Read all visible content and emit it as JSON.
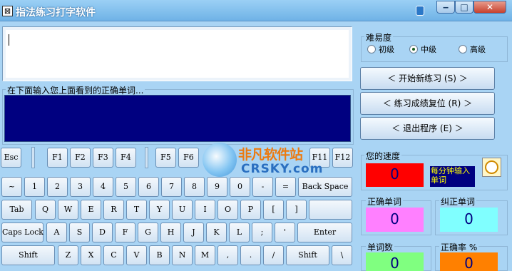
{
  "window": {
    "title": "指法练习打字软件",
    "app_icon_glyph": "⊠"
  },
  "window_controls": {
    "minimize": "‒",
    "maximize": "□",
    "close": "✕"
  },
  "input_prompt": "在下面输入您上面看到的正确单词...",
  "difficulty": {
    "label": "难易度",
    "options": [
      "初级",
      "中级",
      "高级"
    ],
    "selected": "中级"
  },
  "buttons": {
    "new_practice": "＜ 开始新练习 (S) ＞",
    "reset_score": "＜ 练习成绩复位 (R) ＞",
    "exit": "＜ 退出程序 (E) ＞"
  },
  "stats": {
    "speed_label": "您的速度",
    "speed_value": "0",
    "speed_unit": "每分钟输入单词",
    "correct_label": "正确单词",
    "correct_value": "0",
    "corrected_label": "纠正单词",
    "corrected_value": "0",
    "word_count_label": "单词数",
    "word_count_value": "0",
    "accuracy_label": "正确率 %",
    "accuracy_value": "0"
  },
  "watermark": {
    "title": "非凡软件站",
    "subtitle": "CRSKY.com"
  },
  "keyboard": {
    "row0": [
      "Esc",
      "F1",
      "F2",
      "F3",
      "F4",
      "F5",
      "F6",
      "F11",
      "F12"
    ],
    "row1": [
      "~",
      "1",
      "2",
      "3",
      "4",
      "5",
      "6",
      "7",
      "8",
      "9",
      "0",
      "-",
      "=",
      "Back Space"
    ],
    "row2": [
      "Tab",
      "Q",
      "W",
      "E",
      "R",
      "T",
      "Y",
      "U",
      "I",
      "O",
      "P",
      "[",
      "]"
    ],
    "row3": [
      "Caps Lock",
      "A",
      "S",
      "D",
      "F",
      "G",
      "H",
      "J",
      "K",
      "L",
      ";",
      "'",
      "Enter"
    ],
    "row4": [
      "Shift",
      "Z",
      "X",
      "C",
      "V",
      "B",
      "N",
      "M",
      ",",
      ".",
      "/",
      "Shift",
      "\\"
    ]
  },
  "colors": {
    "entry_background": "#000080",
    "speed_box": "#ff0000",
    "speed_unit_box": "#000080",
    "correct_box": "#ff80ff",
    "corrected_box": "#80ffff",
    "word_count_box": "#80ff80",
    "accuracy_box": "#ff8000"
  },
  "icons": {
    "clock": "clock-icon",
    "watermark_logo": "crsky-logo-icon"
  }
}
